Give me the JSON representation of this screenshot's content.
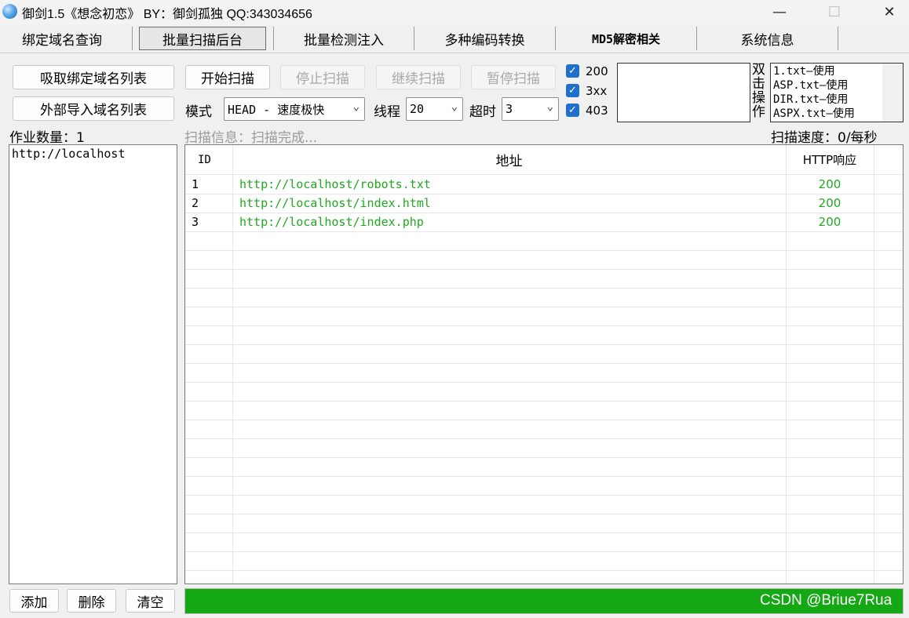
{
  "window": {
    "title": "御剑1.5《想念初恋》 BY：御剑孤独 QQ:343034656",
    "minimize": "—",
    "maximize": "☐",
    "close": "✕"
  },
  "tabs": [
    {
      "label": "绑定域名查询"
    },
    {
      "label": "批量扫描后台"
    },
    {
      "label": "批量检测注入"
    },
    {
      "label": "多种编码转换"
    },
    {
      "label": "MD5解密相关"
    },
    {
      "label": "系统信息"
    }
  ],
  "active_tab": "批量扫描后台",
  "left": {
    "fetch_button": "吸取绑定域名列表",
    "import_button": "外部导入域名列表",
    "job_count_label": "作业数量：1",
    "domains": [
      "http://localhost"
    ],
    "add_button": "添加",
    "delete_button": "删除",
    "clear_button": "清空"
  },
  "controls": {
    "start": "开始扫描",
    "stop": "停止扫描",
    "resume": "继续扫描",
    "pause": "暂停扫描",
    "mode_label": "模式",
    "mode_value": "HEAD - 速度极快",
    "threads_label": "线程",
    "threads_value": "20",
    "timeout_label": "超时",
    "timeout_value": "3",
    "checkboxes": [
      {
        "label": "200",
        "checked": true
      },
      {
        "label": "3xx",
        "checked": true
      },
      {
        "label": "403",
        "checked": true
      }
    ],
    "dict_side_label": [
      "双",
      "击",
      "操",
      "作"
    ],
    "dict_items": [
      "1.txt—使用",
      "ASP.txt—使用",
      "DIR.txt—使用",
      "ASPX.txt—使用"
    ]
  },
  "status": {
    "scan_info": "扫描信息：扫描完成...",
    "scan_speed": "扫描速度：0/每秒",
    "progress": 1.0,
    "progress_color": "#14a814"
  },
  "table": {
    "columns": [
      "ID",
      "地址",
      "HTTP响应"
    ],
    "rows": [
      {
        "id": "1",
        "url": "http://localhost/robots.txt",
        "code": "200"
      },
      {
        "id": "2",
        "url": "http://localhost/index.html",
        "code": "200"
      },
      {
        "id": "3",
        "url": "http://localhost/index.php",
        "code": "200"
      }
    ]
  },
  "watermark": "CSDN @Briue7Rua",
  "colors": {
    "accent": "#1f6fce",
    "ok_green": "#21a821"
  }
}
